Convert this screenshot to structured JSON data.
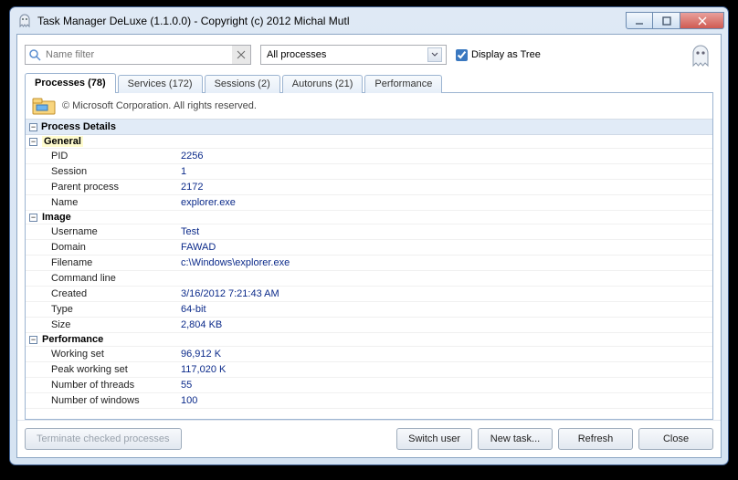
{
  "title": "Task Manager DeLuxe (1.1.0.0) - Copyright (c) 2012 Michal Mutl",
  "filter": {
    "placeholder": "Name filter"
  },
  "combo": {
    "selected": "All processes"
  },
  "tree": {
    "label": "Display as Tree"
  },
  "tabs": {
    "processes": "Processes (78)",
    "services": "Services (172)",
    "sessions": "Sessions (2)",
    "autoruns": "Autoruns (21)",
    "performance": "Performance"
  },
  "copyright": "© Microsoft Corporation. All rights reserved.",
  "section_title": "Process Details",
  "groups": {
    "general": "General",
    "image": "Image",
    "performance": "Performance"
  },
  "rows": {
    "pid_k": "PID",
    "pid_v": "2256",
    "session_k": "Session",
    "session_v": "1",
    "parent_k": "Parent process",
    "parent_v": "2172",
    "name_k": "Name",
    "name_v": "explorer.exe",
    "user_k": "Username",
    "user_v": "Test",
    "domain_k": "Domain",
    "domain_v": "FAWAD",
    "fname_k": "Filename",
    "fname_v": "c:\\Windows\\explorer.exe",
    "cmd_k": "Command line",
    "cmd_v": "",
    "created_k": "Created",
    "created_v": "3/16/2012 7:21:43 AM",
    "type_k": "Type",
    "type_v": "64-bit",
    "size_k": "Size",
    "size_v": "2,804 KB",
    "ws_k": "Working set",
    "ws_v": "96,912 K",
    "pws_k": "Peak working set",
    "pws_v": "117,020 K",
    "thr_k": "Number of threads",
    "thr_v": "55",
    "win_k": "Number of windows",
    "win_v": "100"
  },
  "footer": {
    "terminate": "Terminate checked processes",
    "switch": "Switch user",
    "newtask": "New task...",
    "refresh": "Refresh",
    "close": "Close"
  }
}
